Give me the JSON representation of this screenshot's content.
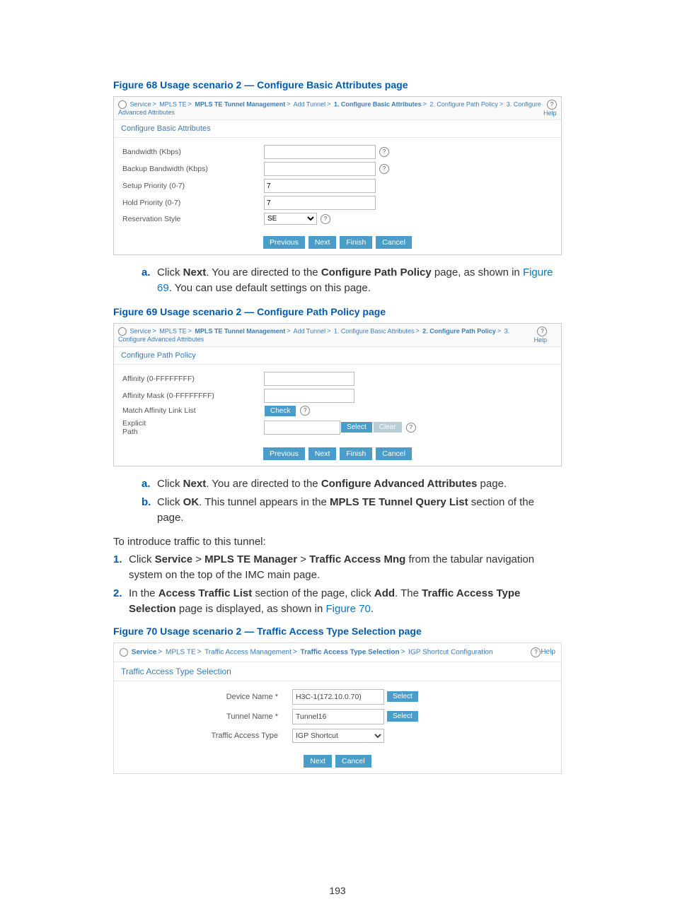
{
  "fig68": {
    "caption": "Figure 68 Usage scenario 2 — Configure Basic Attributes page",
    "breadcrumb": {
      "items": [
        "Service",
        "MPLS TE",
        "MPLS TE Tunnel Management",
        "Add Tunnel",
        "1. Configure Basic Attributes",
        "2. Configure Path Policy",
        "3. Configure Advanced Attributes"
      ],
      "help": "Help"
    },
    "section_title": "Configure Basic Attributes",
    "fields": {
      "bandwidth_label": "Bandwidth (Kbps)",
      "backup_bw_label": "Backup Bandwidth (Kbps)",
      "setup_prio_label": "Setup Priority (0-7)",
      "setup_prio_value": "7",
      "hold_prio_label": "Hold Priority (0-7)",
      "hold_prio_value": "7",
      "res_style_label": "Reservation Style",
      "res_style_value": "SE"
    },
    "buttons": {
      "previous": "Previous",
      "next": "Next",
      "finish": "Finish",
      "cancel": "Cancel"
    }
  },
  "text_after_68": {
    "marker": "a.",
    "body_1": "Click ",
    "b1": "Next",
    "body_2": ". You are directed to the ",
    "b2": "Configure Path Policy",
    "body_3": " page, as shown in ",
    "link": "Figure 69",
    "body_4": ". You can use default settings on this page."
  },
  "fig69": {
    "caption": "Figure 69 Usage scenario 2 — Configure Path Policy page",
    "breadcrumb": {
      "items": [
        "Service",
        "MPLS TE",
        "MPLS TE Tunnel Management",
        "Add Tunnel",
        "1. Configure Basic Attributes",
        "2. Configure Path Policy",
        "3. Configure Advanced Attributes"
      ],
      "help": "Help"
    },
    "section_title": "Configure Path Policy",
    "fields": {
      "affinity_label": "Affinity (0-FFFFFFFF)",
      "mask_label": "Affinity Mask (0-FFFFFFFF)",
      "match_label": "Match Affinity Link List",
      "check_btn": "Check",
      "explicit_label": "Explicit\nPath",
      "select_btn": "Select",
      "clear_btn": "Clear"
    },
    "buttons": {
      "previous": "Previous",
      "next": "Next",
      "finish": "Finish",
      "cancel": "Cancel"
    }
  },
  "text_after_69": {
    "a_marker": "a.",
    "a_1": "Click ",
    "a_b1": "Next",
    "a_2": ". You are directed to the ",
    "a_b2": "Configure Advanced Attributes",
    "a_3": " page.",
    "b_marker": "b.",
    "b_1": "Click ",
    "b_b1": "OK",
    "b_2": ". This tunnel appears in the ",
    "b_b2": "MPLS TE Tunnel Query List",
    "b_3": " section of the page."
  },
  "intro_after": "To introduce traffic to this tunnel:",
  "s1": {
    "marker": "1.",
    "t1": "Click ",
    "b1": "Service",
    "t2": " > ",
    "b2": "MPLS TE Manager",
    "t3": " > ",
    "b3": "Traffic Access Mng",
    "t4": " from the tabular navigation system on the top of the IMC main page."
  },
  "s2": {
    "marker": "2.",
    "t1": "In the ",
    "b1": "Access Traffic List",
    "t2": " section of the page, click ",
    "b2": "Add",
    "t3": ". The ",
    "b3": "Traffic Access Type Selection",
    "t4": " page is displayed, as shown in ",
    "link": "Figure 70",
    "t5": "."
  },
  "fig70": {
    "caption": "Figure 70 Usage scenario 2 — Traffic Access Type Selection page",
    "breadcrumb": {
      "items": [
        "Service",
        "MPLS TE",
        "Traffic Access Management",
        "Traffic Access Type Selection",
        "IGP Shortcut Configuration"
      ],
      "help": "Help"
    },
    "section_title": "Traffic Access Type Selection",
    "fields": {
      "device_label": "Device Name *",
      "device_value": "H3C-1(172.10.0.70)",
      "tunnel_label": "Tunnel Name *",
      "tunnel_value": "Tunnel16",
      "type_label": "Traffic Access Type",
      "type_value": "IGP Shortcut",
      "select_btn": "Select"
    },
    "buttons": {
      "next": "Next",
      "cancel": "Cancel"
    }
  },
  "page_number": "193"
}
